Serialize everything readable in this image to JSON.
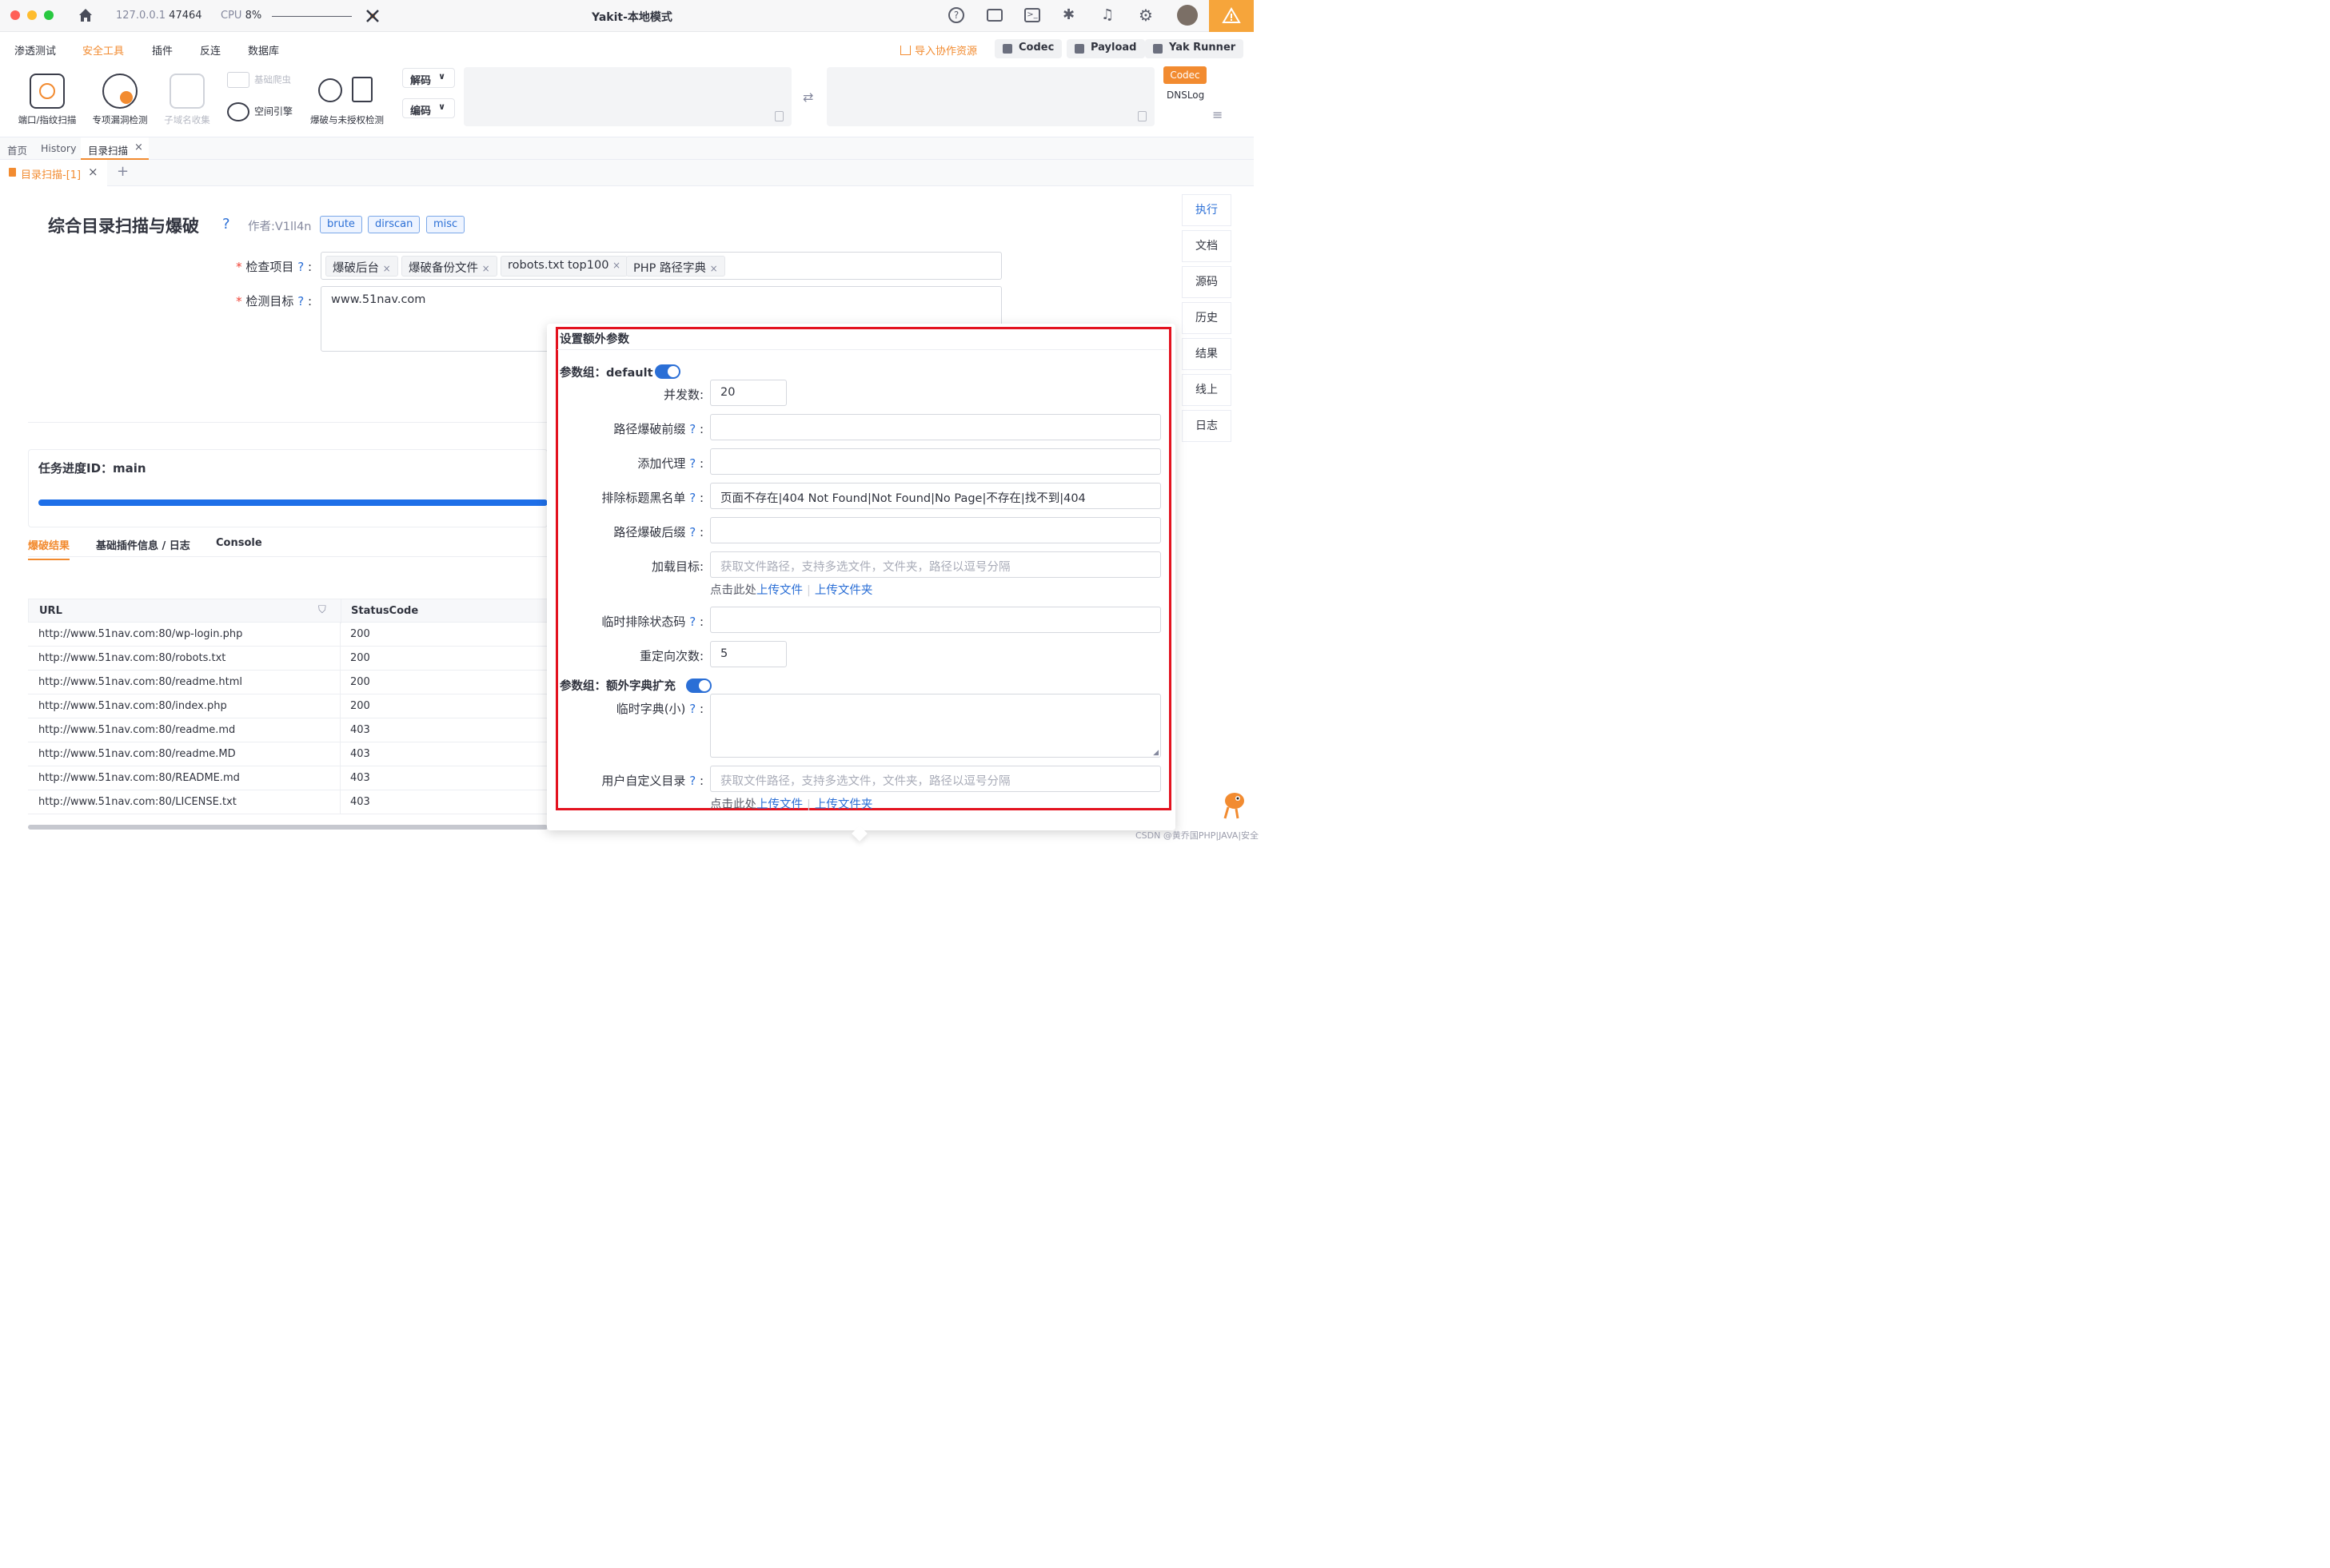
{
  "titlebar": {
    "host": "127.0.0.1",
    "port": "47464",
    "cpu_label": "CPU",
    "cpu_value": "8%",
    "title": "Yakit-本地模式"
  },
  "menubar": {
    "items": [
      "渗透测试",
      "安全工具",
      "插件",
      "反连",
      "数据库"
    ],
    "active": "安全工具",
    "import_label": "导入协作资源",
    "buttons": [
      "Codec",
      "Payload",
      "Yak Runner"
    ]
  },
  "toolbar": {
    "tools": [
      "端口/指纹扫描",
      "专项漏洞检测",
      "子域名收集",
      "基础爬虫",
      "空间引擎",
      "爆破与未授权检测"
    ],
    "decode_label": "解码",
    "encode_label": "编码",
    "codec_tag": "Codec",
    "dnslog_tag": "DNSLog"
  },
  "tabs": {
    "primary": [
      "首页",
      "History",
      "目录扫描"
    ],
    "secondary": "目录扫描-[1]"
  },
  "plugin": {
    "title": "综合目录扫描与爆破",
    "author": "作者:V1ll4n",
    "tags": [
      "brute",
      "dirscan",
      "misc"
    ],
    "check_label": "检查项目",
    "check_items": [
      "爆破后台",
      "爆破备份文件",
      "robots.txt top100",
      "PHP 路径字典"
    ],
    "target_label": "检测目标",
    "target_value": "www.51nav.com"
  },
  "side_buttons": [
    "执行",
    "文档",
    "源码",
    "历史",
    "结果",
    "线上",
    "日志"
  ],
  "progress": {
    "label": "任务进度ID：main",
    "fraction": 1.0
  },
  "result_tabs": [
    "爆破结果",
    "基础插件信息 / 日志",
    "Console"
  ],
  "table": {
    "headers": [
      "URL",
      "StatusCode"
    ],
    "rows": [
      [
        "http://www.51nav.com:80/wp-login.php",
        "200"
      ],
      [
        "http://www.51nav.com:80/robots.txt",
        "200"
      ],
      [
        "http://www.51nav.com:80/readme.html",
        "200"
      ],
      [
        "http://www.51nav.com:80/index.php",
        "200"
      ],
      [
        "http://www.51nav.com:80/readme.md",
        "403"
      ],
      [
        "http://www.51nav.com:80/readme.MD",
        "403"
      ],
      [
        "http://www.51nav.com:80/README.md",
        "403"
      ],
      [
        "http://www.51nav.com:80/LICENSE.txt",
        "403"
      ]
    ]
  },
  "popup": {
    "title": "设置额外参数",
    "group1_label": "参数组：default",
    "concurrency_label": "并发数:",
    "concurrency_value": "20",
    "prefix_label": "路径爆破前缀",
    "proxy_label": "添加代理",
    "blacklist_label": "排除标题黑名单",
    "blacklist_value": "页面不存在|404 Not Found|Not Found|No Page|不存在|找不到|404",
    "suffix_label": "路径爆破后缀",
    "load_target_label": "加载目标:",
    "file_placeholder": "获取文件路径，支持多选文件，文件夹，路径以逗号分隔",
    "upload_hint": "点击此处",
    "upload_file": "上传文件",
    "upload_folder": "上传文件夹",
    "exclude_code_label": "临时排除状态码",
    "redirect_label": "重定向次数:",
    "redirect_value": "5",
    "group2_label": "参数组：额外字典扩充",
    "temp_dict_label": "临时字典(小)",
    "custom_dir_label": "用户自定义目录"
  },
  "watermark": "CSDN @黄乔国PHP|JAVA|安全"
}
